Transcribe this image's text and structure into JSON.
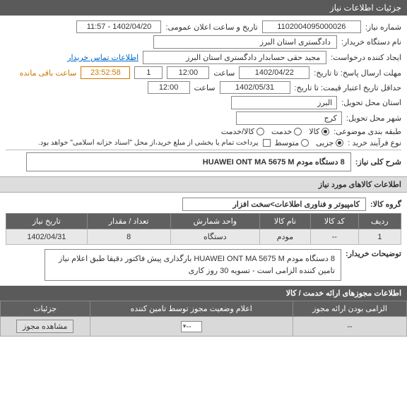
{
  "header": {
    "title": "جزئیات اطلاعات نیاز"
  },
  "fields": {
    "need_no_label": "شماره نیاز:",
    "need_no": "1102004095000026",
    "announce_label": "تاریخ و ساعت اعلان عمومی:",
    "announce_value": "1402/04/20 - 11:57",
    "buyer_org_label": "نام دستگاه خریدار:",
    "buyer_org": "دادگستری استان البرز",
    "requester_label": "ایجاد کننده درخواست:",
    "requester": "مجید حقی حسابدار دادگستری استان البرز",
    "contact_link": "اطلاعات تماس خریدار",
    "reply_deadline_label": "مهلت ارسال پاسخ: تا تاریخ:",
    "reply_date": "1402/04/22",
    "time_label": "ساعت",
    "reply_time": "12:00",
    "reply_count": "1",
    "remaining_label": "ساعت باقی مانده",
    "remaining": "23:52:58",
    "price_validity_label": "حداقل تاریخ اعتبار قیمت: تا تاریخ:",
    "price_date": "1402/05/31",
    "price_time": "12:00",
    "province_label": "استان محل تحویل:",
    "province": "البرز",
    "city_label": "شهر محل تحویل:",
    "city": "کرج",
    "subject_class_label": "طبقه بندی موضوعی:",
    "class_goods": "کالا",
    "class_service": "خدمت",
    "class_both": "کالا/خدمت",
    "process_label": "نوع فرآیند خرید :",
    "proc_partial": "جزیی",
    "proc_medium": "متوسط",
    "proc_note": "پرداخت تمام یا بخشی از مبلغ خرید،از محل \"اسناد خزانه اسلامی\" خواهد بود.",
    "need_title_label": "شرح کلی نیاز:",
    "need_title": "8 دستگاه مودم HUAWEI ONT MA 5675 M"
  },
  "goods_section": {
    "title": "اطلاعات کالاهای مورد نیاز",
    "group_label": "گروه کالا:",
    "group_value": "کامپیوتر و فناوری اطلاعات>سخت افزار",
    "headers": {
      "row": "ردیف",
      "code": "کد کالا",
      "name": "نام کالا",
      "unit": "واحد شمارش",
      "qty": "تعداد / مقدار",
      "date": "تاریخ نیاز"
    },
    "rows": [
      {
        "row": "1",
        "code": "--",
        "name": "مودم",
        "unit": "دستگاه",
        "qty": "8",
        "date": "1402/04/31"
      }
    ],
    "buyer_note_label": "توضیحات خریدار:",
    "buyer_note": "8 دستگاه مودم HUAWEI ONT MA 5675 M بارگذاری پیش فاکتور دقیقا طبق اعلام نیاز تامین کننده الزامی است - تسویه 30 روز کاری"
  },
  "permits_section": {
    "title": "اطلاعات مجوزهای ارائه خدمت / کالا",
    "headers": {
      "mandatory": "الزامی بودن ارائه مجوز",
      "status": "اعلام وضعیت مجوز توسط تامین کننده",
      "details": "جزئیات"
    },
    "row": {
      "mandatory": "--",
      "status_sel": "--",
      "btn": "مشاهده مجوز"
    }
  }
}
